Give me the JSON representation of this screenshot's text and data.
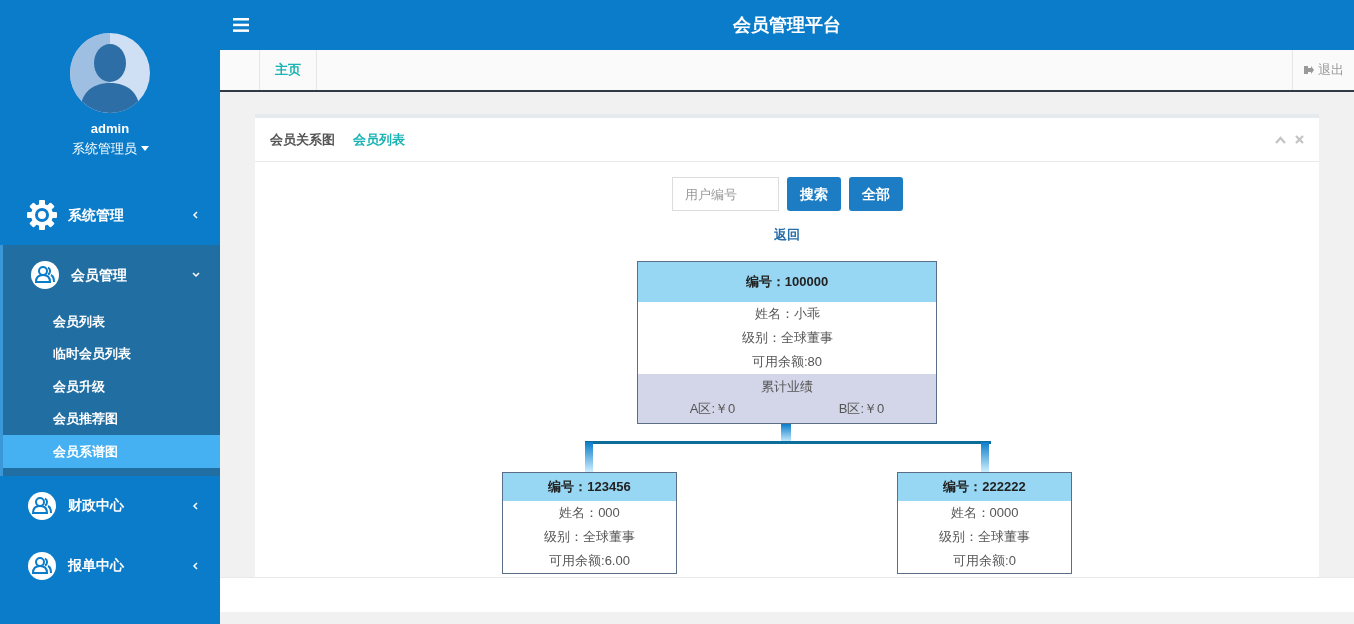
{
  "header": {
    "title": "会员管理平台"
  },
  "user": {
    "name": "admin",
    "role": "系统管理员"
  },
  "sidebar": {
    "items": [
      {
        "label": "系统管理",
        "kind": "gear",
        "expanded": false
      },
      {
        "label": "会员管理",
        "kind": "users",
        "expanded": true,
        "children": [
          {
            "label": "会员列表",
            "selected": false
          },
          {
            "label": "临时会员列表",
            "selected": false
          },
          {
            "label": "会员升级",
            "selected": false
          },
          {
            "label": "会员推荐图",
            "selected": false
          },
          {
            "label": "会员系谱图",
            "selected": true
          }
        ]
      },
      {
        "label": "财政中心",
        "kind": "users",
        "expanded": false
      },
      {
        "label": "报单中心",
        "kind": "users",
        "expanded": false
      }
    ]
  },
  "page_tabs": [
    {
      "label": "主页",
      "selected": true
    }
  ],
  "logout": "退出",
  "panel": {
    "tabs": [
      {
        "label": "会员关系图",
        "selected": true
      },
      {
        "label": "会员列表",
        "selected": false
      }
    ],
    "search": {
      "placeholder": "用户编号"
    },
    "buttons": [
      "搜索",
      "全部"
    ],
    "back_link": "返回",
    "tree": {
      "id": "编号：100000",
      "lines": [
        "姓名：小乖",
        "级别：全球董事",
        "可用余额:80"
      ],
      "performance": {
        "title": "累计业绩",
        "a": "A区:￥0",
        "b": "B区:￥0"
      },
      "children": [
        {
          "id": "编号：123456",
          "lines": [
            "姓名：000",
            "级别：全球董事",
            "可用余额:6.00"
          ]
        },
        {
          "id": "编号：222222",
          "lines": [
            "姓名：0000",
            "级别：全球董事",
            "可用余额:0"
          ]
        }
      ]
    }
  }
}
